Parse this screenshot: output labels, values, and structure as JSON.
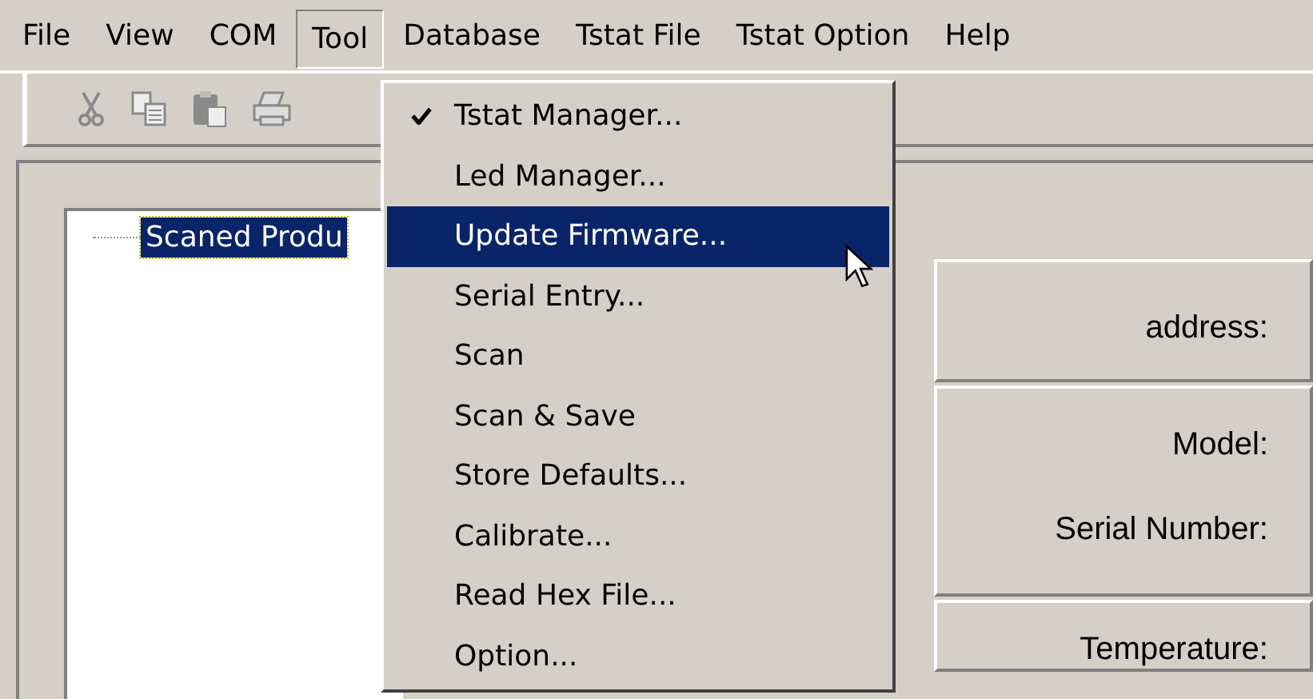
{
  "menu_bar": [
    {
      "label": "File",
      "selected": false
    },
    {
      "label": "View",
      "selected": false
    },
    {
      "label": "COM",
      "selected": false
    },
    {
      "label": "Tool",
      "selected": true
    },
    {
      "label": "Database",
      "selected": false
    },
    {
      "label": "Tstat File",
      "selected": false
    },
    {
      "label": "Tstat Option",
      "selected": false
    },
    {
      "label": "Help",
      "selected": false
    }
  ],
  "tool_menu": [
    {
      "label": "Tstat Manager...",
      "checked": true,
      "selected": false
    },
    {
      "label": "Led Manager...",
      "checked": false,
      "selected": false
    },
    {
      "label": "Update Firmware...",
      "checked": false,
      "selected": true
    },
    {
      "label": "Serial Entry...",
      "checked": false,
      "selected": false
    },
    {
      "label": "Scan",
      "checked": false,
      "selected": false
    },
    {
      "label": "Scan & Save",
      "checked": false,
      "selected": false
    },
    {
      "label": "Store Defaults...",
      "checked": false,
      "selected": false
    },
    {
      "label": "Calibrate...",
      "checked": false,
      "selected": false
    },
    {
      "label": "Read Hex File...",
      "checked": false,
      "selected": false
    },
    {
      "label": "Option...",
      "checked": false,
      "selected": false
    }
  ],
  "tree": {
    "items": [
      {
        "label": "Scaned Produ",
        "selected": true
      }
    ]
  },
  "device_panel": {
    "groups": [
      [
        "address:"
      ],
      [
        "Model:",
        "Serial Number:"
      ],
      [
        "Temperature:"
      ]
    ]
  }
}
